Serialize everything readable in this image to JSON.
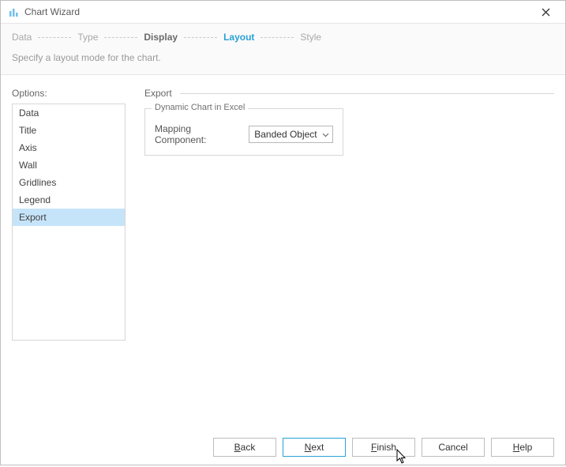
{
  "window": {
    "title": "Chart Wizard"
  },
  "steps": {
    "items": [
      {
        "label": "Data"
      },
      {
        "label": "Type"
      },
      {
        "label": "Display"
      },
      {
        "label": "Layout"
      },
      {
        "label": "Style"
      }
    ]
  },
  "subtitle": "Specify a layout mode for the chart.",
  "options": {
    "label": "Options:",
    "items": [
      {
        "label": "Data"
      },
      {
        "label": "Title"
      },
      {
        "label": "Axis"
      },
      {
        "label": "Wall"
      },
      {
        "label": "Gridlines"
      },
      {
        "label": "Legend"
      },
      {
        "label": "Export"
      }
    ],
    "selected_index": 6
  },
  "content": {
    "section_title": "Export",
    "group_legend": "Dynamic Chart in Excel",
    "mapping_label": "Mapping Component:",
    "mapping_value": "Banded Object"
  },
  "buttons": {
    "back": "Back",
    "next": "Next",
    "finish": "Finish",
    "cancel": "Cancel",
    "help": "Help"
  }
}
